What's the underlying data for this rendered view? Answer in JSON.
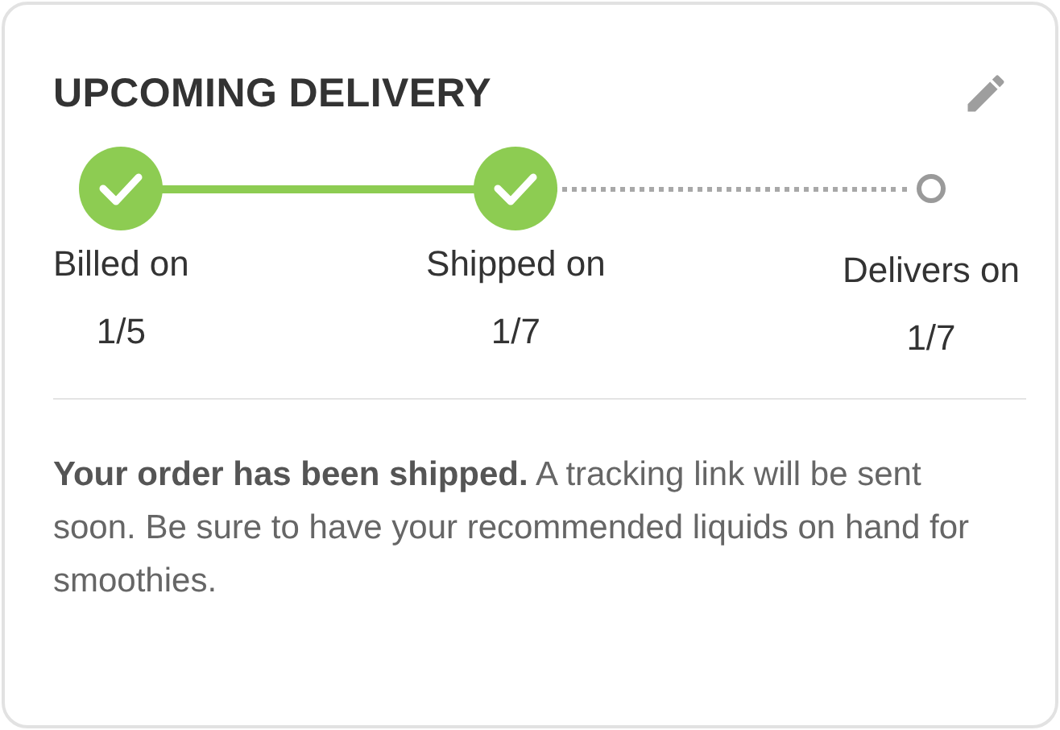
{
  "card": {
    "title": "UPCOMING DELIVERY"
  },
  "steps": [
    {
      "label": "Billed on",
      "date": "1/5",
      "done": true
    },
    {
      "label": "Shipped on",
      "date": "1/7",
      "done": true
    },
    {
      "label": "Delivers on",
      "date": "1/7",
      "done": false
    }
  ],
  "message": "**Your order has been shipped.** A tracking link will be sent soon. Be sure to have your recommended liquids on hand for smoothies."
}
